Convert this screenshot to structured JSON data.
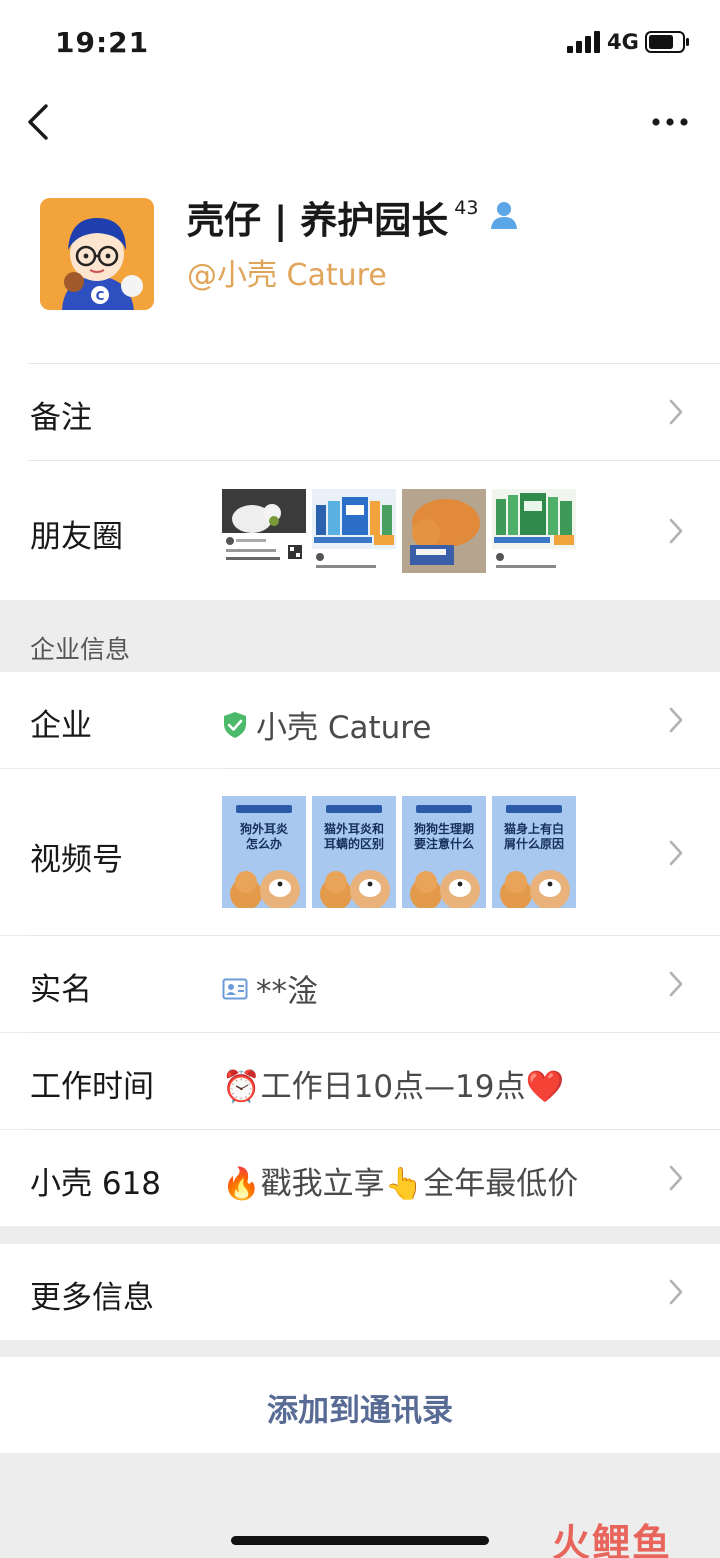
{
  "status_bar": {
    "time": "19:21",
    "network": "4G"
  },
  "profile": {
    "name": "壳仔 | 养护园长",
    "name_superscript": "43",
    "handle": "@小壳 Cature"
  },
  "rows": {
    "remark": {
      "label": "备注"
    },
    "moments": {
      "label": "朋友圈"
    },
    "section_title": "企业信息",
    "company": {
      "label": "企业",
      "value": "小壳 Cature"
    },
    "channels": {
      "label": "视频号",
      "videos": [
        {
          "caption_line1": "狗外耳炎",
          "caption_line2": "怎么办"
        },
        {
          "caption_line1": "猫外耳炎和",
          "caption_line2": "耳螨的区别"
        },
        {
          "caption_line1": "狗狗生理期",
          "caption_line2": "要注意什么"
        },
        {
          "caption_line1": "猫身上有白",
          "caption_line2": "屑什么原因"
        }
      ]
    },
    "real_name": {
      "label": "实名",
      "value": "**淦"
    },
    "work_time": {
      "label": "工作时间",
      "value": "⏰工作日10点—19点❤️"
    },
    "promo": {
      "label": "小壳 618",
      "value": "🔥戳我立享👆全年最低价"
    },
    "more_info": {
      "label": "更多信息"
    }
  },
  "actions": {
    "add_to_contacts": "添加到通讯录"
  },
  "watermark": "火鲤鱼",
  "colors": {
    "link": "#576b95",
    "handle": "#e0a45a",
    "verified": "#4cba6b"
  }
}
